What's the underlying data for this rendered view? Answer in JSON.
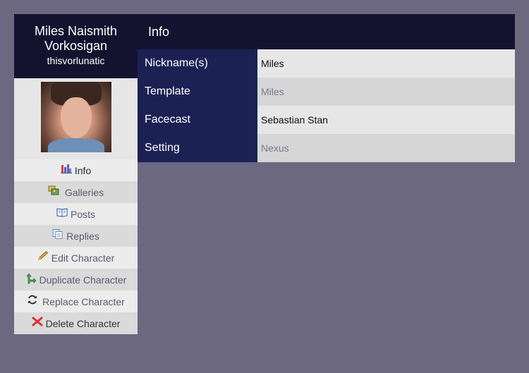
{
  "character": {
    "name": "Miles Naismith Vorkosigan",
    "username": "thisvorlunatic"
  },
  "nav": [
    {
      "label": "Info",
      "icon": "chart-icon"
    },
    {
      "label": "Galleries",
      "icon": "galleries-icon"
    },
    {
      "label": "Posts",
      "icon": "book-icon"
    },
    {
      "label": "Replies",
      "icon": "replies-icon"
    },
    {
      "label": "Edit Character",
      "icon": "pencil-icon"
    },
    {
      "label": "Duplicate Character",
      "icon": "duplicate-arrow-icon"
    },
    {
      "label": "Replace Character",
      "icon": "refresh-icon"
    },
    {
      "label": "Delete Character",
      "icon": "delete-x-icon"
    }
  ],
  "main": {
    "title": "Info",
    "rows": [
      {
        "label": "Nickname(s)",
        "value": "Miles"
      },
      {
        "label": "Template",
        "value": "Miles"
      },
      {
        "label": "Facecast",
        "value": "Sebastian Stan"
      },
      {
        "label": "Setting",
        "value": "Nexus"
      }
    ]
  }
}
